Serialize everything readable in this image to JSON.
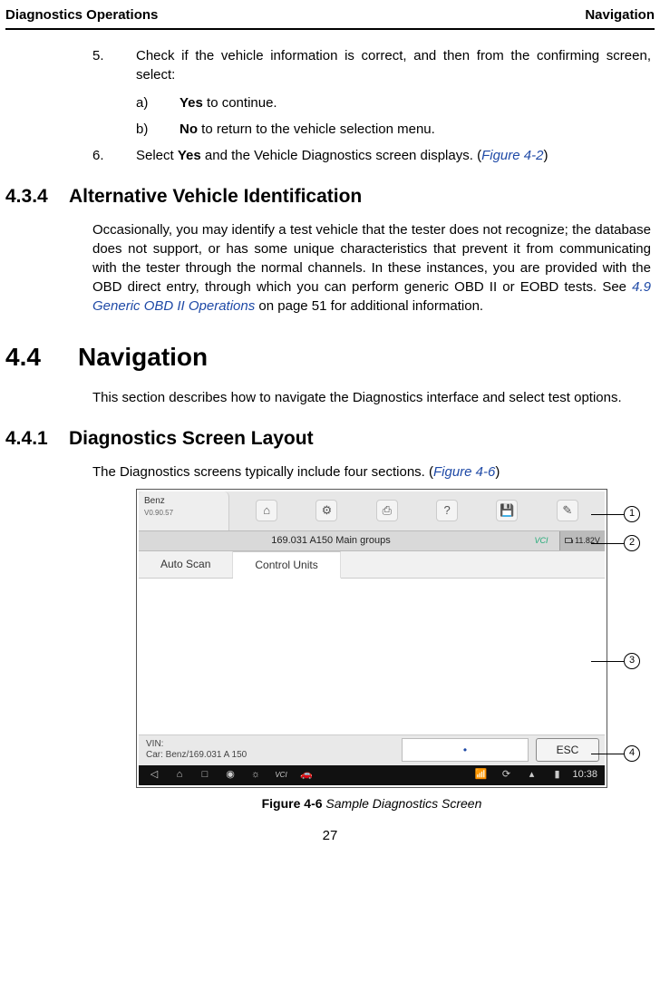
{
  "header": {
    "left": "Diagnostics Operations",
    "right": "Navigation"
  },
  "steps": {
    "five": {
      "num": "5.",
      "text_a": "Check if the vehicle information is correct, and then from the confirming screen, select:"
    },
    "five_a": {
      "letter": "a)",
      "bold": "Yes",
      "rest": " to continue."
    },
    "five_b": {
      "letter": "b)",
      "bold": "No",
      "rest": " to return to the vehicle selection menu."
    },
    "six": {
      "num": "6.",
      "pre": "Select ",
      "bold": "Yes",
      "mid": " and the Vehicle Diagnostics screen displays. (",
      "link": "Figure 4-2",
      "post": ")"
    }
  },
  "sec434": {
    "num": "4.3.4",
    "title": "Alternative Vehicle Identification",
    "para_pre": "Occasionally, you may identify a test vehicle that the tester does not recognize; the database does not support, or has some unique characteristics that prevent it from communicating with the tester through the normal channels. In these instances, you are provided with the OBD direct entry, through which you can perform generic OBD II or EOBD tests. See ",
    "para_link": "4.9 Generic OBD II Operations",
    "para_post": " on page 51 for additional information."
  },
  "sec44": {
    "num": "4.4",
    "title": "Navigation",
    "para": "This section describes how to navigate the Diagnostics interface and select test options."
  },
  "sec441": {
    "num": "4.4.1",
    "title": "Diagnostics Screen Layout",
    "para_pre": "The Diagnostics screens typically include four sections. (",
    "para_link": "Figure 4-6",
    "para_post": ")"
  },
  "screenshot": {
    "brand": "Benz",
    "version": "V0.90.57",
    "icons": {
      "home": "⌂",
      "settings": "⚙",
      "print": "⎙",
      "help": "?",
      "save": "💾",
      "edit": "✎"
    },
    "subbar_title": "169.031 A150 Main groups",
    "vci": "VCI",
    "battery": "11.82V",
    "tab1": "Auto Scan",
    "tab2": "Control Units",
    "vin_label": "VIN:",
    "car_label": "Car: Benz/169.031 A 150",
    "dot": "•",
    "esc": "ESC",
    "sys": {
      "back": "◁",
      "home": "⌂",
      "recent": "□",
      "cam": "◉",
      "bright": "☼",
      "vci_icon": "VCI",
      "car": "🚗",
      "wifi": "📶",
      "sync": "⟳",
      "up": "▴",
      "batt": "▮"
    },
    "time": "10:38",
    "callouts": {
      "c1": "1",
      "c2": "2",
      "c3": "3",
      "c4": "4"
    }
  },
  "figure": {
    "label": "Figure 4-6",
    "caption": " Sample Diagnostics Screen"
  },
  "page": "27"
}
